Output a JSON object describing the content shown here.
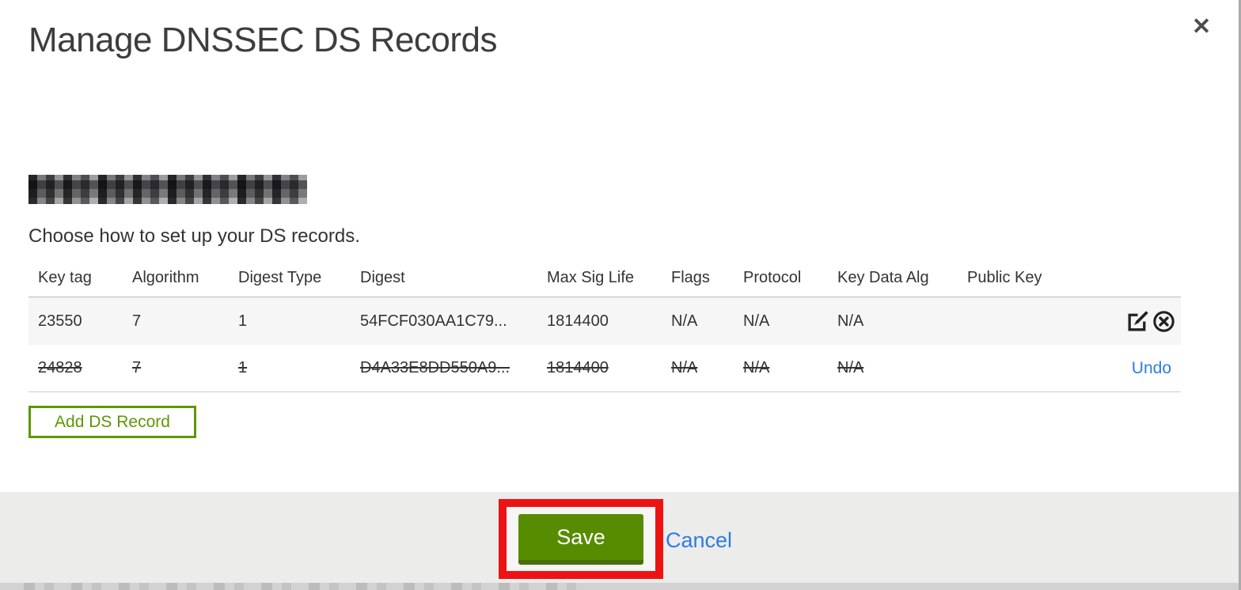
{
  "window": {
    "title": "Manage DNSSEC DS Records",
    "close_glyph": "✕"
  },
  "content": {
    "domain": {
      "redacted": true
    },
    "instruction": "Choose how to set up your DS records."
  },
  "table": {
    "headers": [
      "Key tag",
      "Algorithm",
      "Digest Type",
      "Digest",
      "Max Sig Life",
      "Flags",
      "Protocol",
      "Key Data Alg",
      "Public Key"
    ],
    "rows": [
      {
        "key_tag": "23550",
        "algorithm": "7",
        "digest_type": "1",
        "digest": "54FCF030AA1C79...",
        "max_sig_life": "1814400",
        "flags": "N/A",
        "protocol": "N/A",
        "key_data_alg": "N/A",
        "public_key": "",
        "state": "active"
      },
      {
        "key_tag": "24828",
        "algorithm": "7",
        "digest_type": "1",
        "digest": "D4A33E8DD550A9...",
        "max_sig_life": "1814400",
        "flags": "N/A",
        "protocol": "N/A",
        "key_data_alg": "N/A",
        "public_key": "",
        "state": "marked-for-deletion",
        "undo_label": "Undo"
      }
    ]
  },
  "actions": {
    "add_ds_record": "Add DS Record",
    "save": "Save",
    "cancel": "Cancel"
  },
  "colors": {
    "action_green": "#5e9700",
    "save_green": "#578c00",
    "link_blue": "#2d7ce1",
    "annotation_red": "#ee1313",
    "footer_gray": "#ececeb",
    "row_gray": "#f6f6f6"
  }
}
